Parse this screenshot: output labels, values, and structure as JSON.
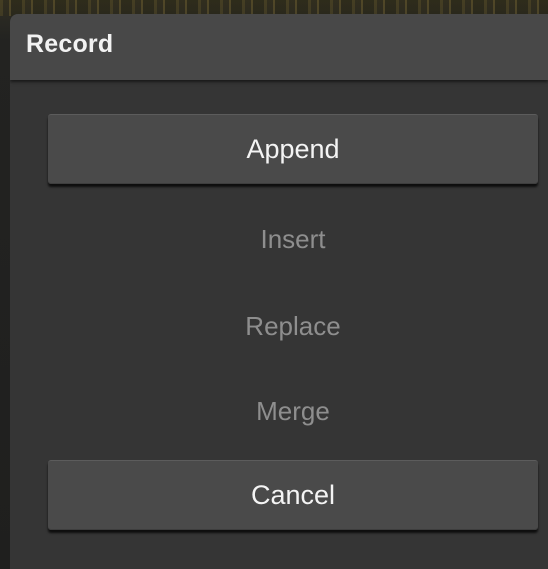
{
  "dialog": {
    "title": "Record",
    "primary_option": "Append",
    "options": [
      {
        "label": "Insert",
        "enabled": false
      },
      {
        "label": "Replace",
        "enabled": false
      },
      {
        "label": "Merge",
        "enabled": false
      }
    ],
    "cancel_label": "Cancel"
  }
}
